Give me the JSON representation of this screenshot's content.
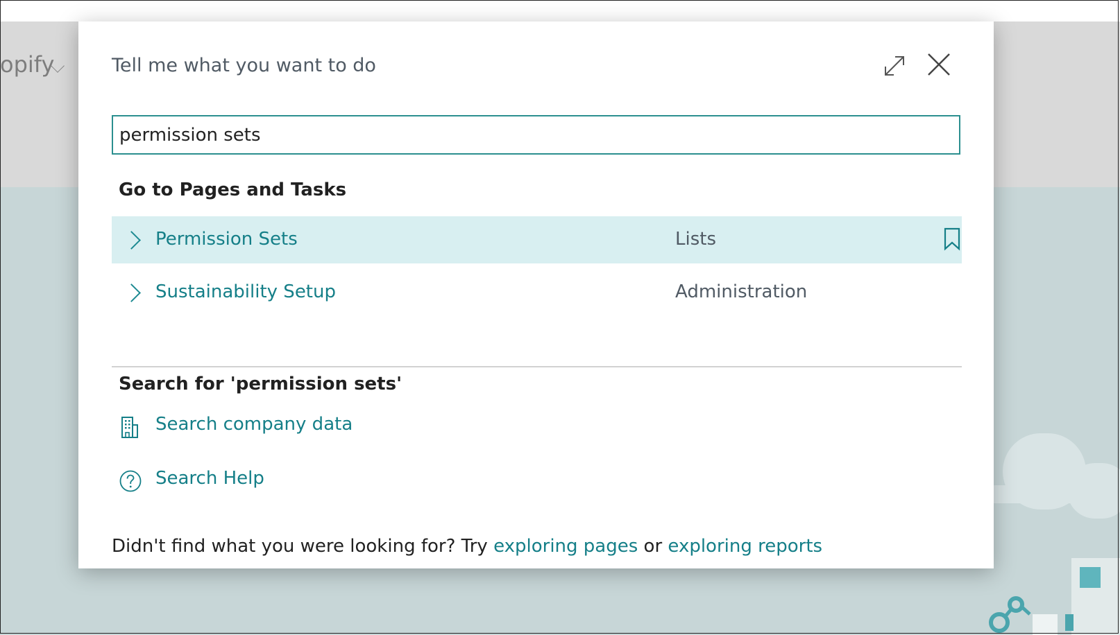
{
  "background": {
    "nav_text": "opify"
  },
  "dialog": {
    "title": "Tell me what you want to do",
    "search": {
      "value": "permission sets",
      "placeholder": ""
    },
    "pages_section": {
      "heading": "Go to Pages and Tasks",
      "results": [
        {
          "label": "Permission Sets",
          "category": "Lists",
          "selected": true
        },
        {
          "label": "Sustainability Setup",
          "category": "Administration",
          "selected": false
        }
      ]
    },
    "search_section": {
      "heading": "Search for 'permission sets'",
      "actions": [
        {
          "label": "Search company data",
          "icon": "building-icon"
        },
        {
          "label": "Search Help",
          "icon": "help-circle-icon"
        }
      ]
    },
    "footer": {
      "prefix": "Didn't find what you were looking for? Try ",
      "link1": "exploring pages",
      "middle": " or ",
      "link2": "exploring reports"
    }
  },
  "colors": {
    "accent": "#157f88",
    "selected_row": "#d8eff1",
    "search_border": "#2b8f8f"
  }
}
